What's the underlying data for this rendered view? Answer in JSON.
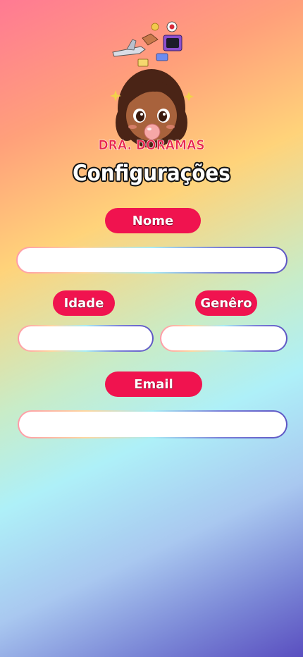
{
  "header": {
    "logo_text": "DRA. DORAMAS",
    "title": "Configurações"
  },
  "form": {
    "name_label": "Nome",
    "name_value": "",
    "age_label": "Idade",
    "age_value": "",
    "gender_label": "Genêro",
    "gender_value": "",
    "email_label": "Email",
    "email_value": ""
  },
  "colors": {
    "accent": "#f0134f",
    "logo_text": "#e8264d"
  }
}
